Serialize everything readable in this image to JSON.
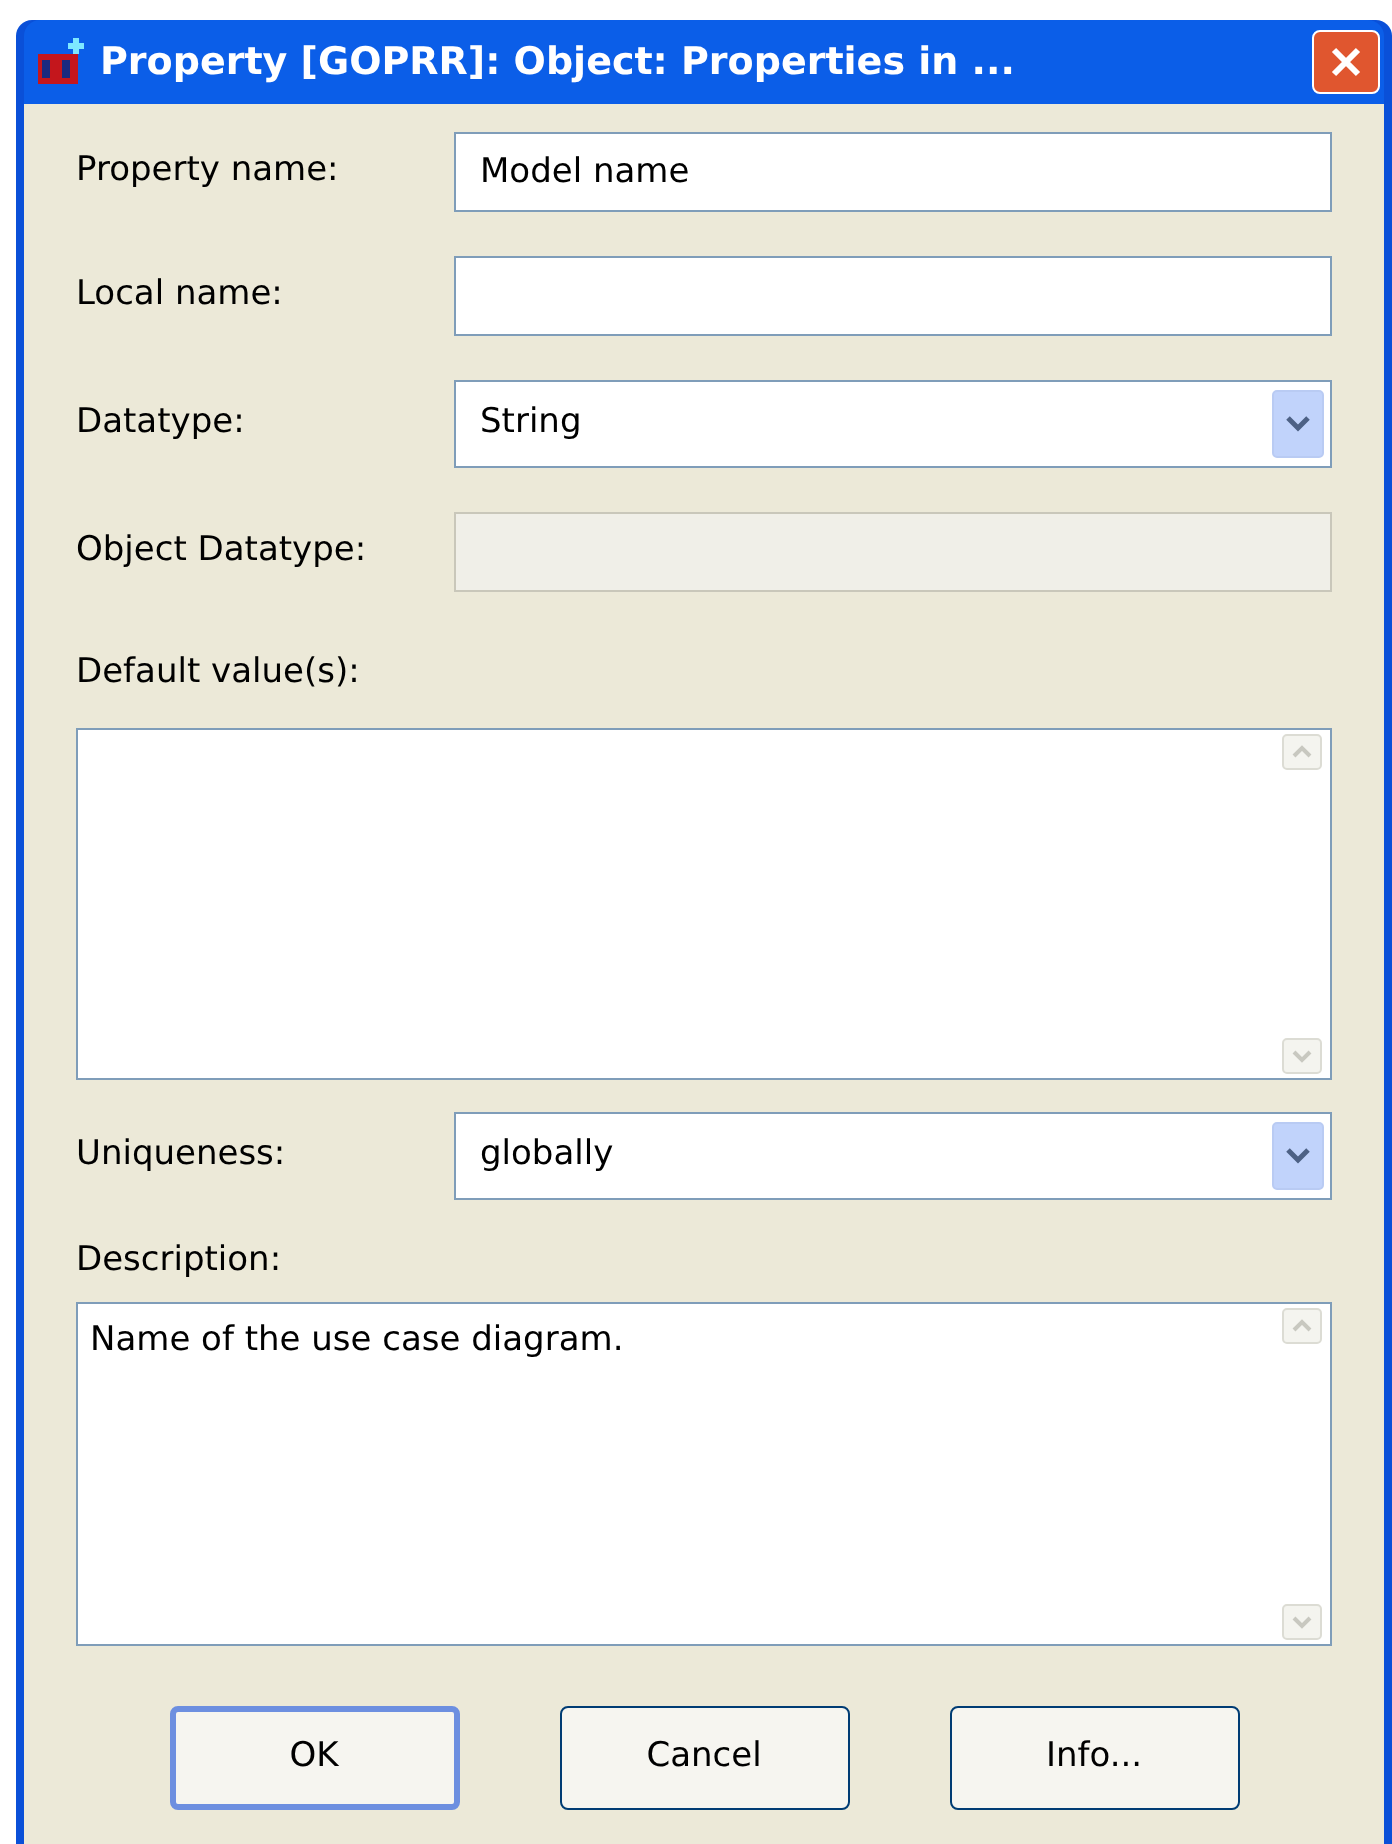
{
  "window": {
    "title": "Property [GOPRR]: Object: Properties in ..."
  },
  "fields": [
    {
      "kind": "text",
      "label": "Property name:",
      "value": "Model name",
      "disabled": false
    },
    {
      "kind": "text",
      "label": "Local name:",
      "disabled": false
    },
    {
      "kind": "combo",
      "label": "Datatype:",
      "value": "String",
      "disabled": false
    },
    {
      "kind": "text",
      "label": "Object Datatype:",
      "disabled": true
    }
  ],
  "default_values": {
    "label": "Default value(s):"
  },
  "uniqueness": {
    "kind": "combo",
    "label": "Uniqueness:",
    "value": "globally",
    "disabled": false
  },
  "description": {
    "label": "Description:",
    "value": "Name of the use case diagram."
  },
  "buttons": [
    {
      "label": "OK",
      "default": true
    },
    {
      "label": "Cancel",
      "default": false
    },
    {
      "label": "Info...",
      "default": false
    }
  ]
}
